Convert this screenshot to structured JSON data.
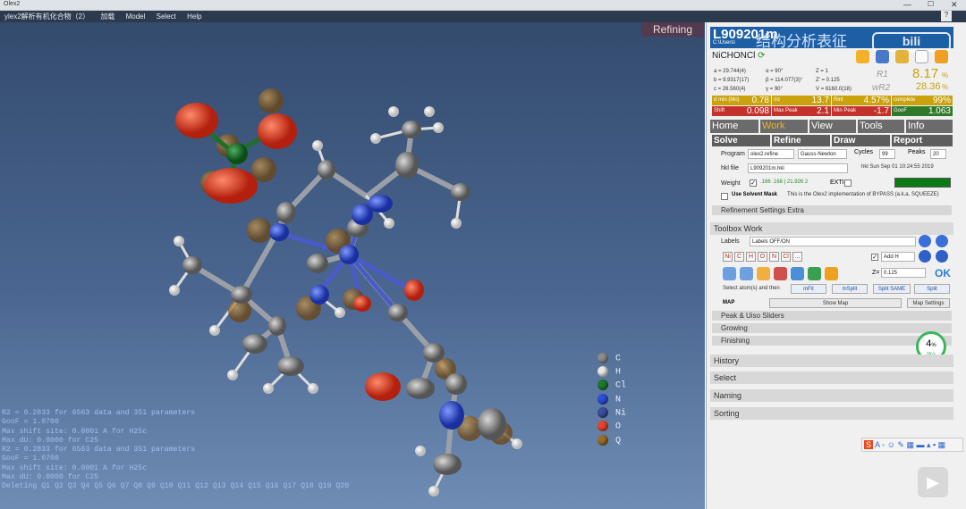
{
  "window": {
    "title": "Olex2"
  },
  "menu": {
    "items": [
      "ylex2解析有机化合物（2）",
      "加载",
      "Model",
      "Select",
      "Help"
    ]
  },
  "viewport": {
    "status_overlay": "Refining",
    "console_lines": [
      "R2 = 0.2833 for 6563 data and 351 parameters",
      "GooF = 1.0700",
      "Max shift site: 0.0001 A for H25c",
      "Max dU: 0.0000 for C25",
      "R2 = 0.2833 for 6563 data and 351 parameters",
      "GooF = 1.0700",
      "Max shift site: 0.0001 A for H25c",
      "Max dU: 0.0000 for C25",
      "Deleting Q1 Q2 Q3 Q4 Q5 Q6 Q7 Q8 Q9 Q10 Q11 Q12 Q13 Q14 Q15 Q16 Q17 Q18 Q19 Q20"
    ],
    "legend": [
      {
        "label": "C",
        "color": "#8c8c8c"
      },
      {
        "label": "H",
        "color": "#e8e8e8"
      },
      {
        "label": "Cl",
        "color": "#1f7a2e"
      },
      {
        "label": "N",
        "color": "#2b4fd9"
      },
      {
        "label": "Ni",
        "color": "#3a4f9e"
      },
      {
        "label": "O",
        "color": "#e6452d"
      },
      {
        "label": "Q",
        "color": "#9a6d2a"
      }
    ]
  },
  "panel": {
    "structure_name": "L909201m",
    "structure_path": "C:\\Users\\",
    "overlay_watermark": "结构分析表征",
    "formula": "NiCHONCl",
    "cell": {
      "a": "a = 29.744(4)",
      "alpha": "α = 90°",
      "Z": "Z = 1",
      "b": "b = 9.9317(17)",
      "beta": "β = 114.077(3)°",
      "Zp": "Z' = 0.125",
      "c": "c = 26.560(4)",
      "gamma": "γ = 90°",
      "V": "V = 6160.0(18)"
    },
    "r1_label": "R1",
    "r1_value": "8.17",
    "wr2_label": "wR2",
    "wr2_value": "28.36",
    "pct": "%",
    "stats": [
      {
        "label": "d min (Mo)",
        "value": "0.78",
        "color": "#c9a20d"
      },
      {
        "label": "I/σ",
        "value": "13.7",
        "color": "#c9a20d"
      },
      {
        "label": "Rint",
        "value": "4.57%",
        "color": "#c9a20d"
      },
      {
        "label": "complete",
        "value": "99%",
        "color": "#c9a20d"
      },
      {
        "label": "Shift",
        "value": "0.098",
        "color": "#c3322a"
      },
      {
        "label": "Max Peak",
        "value": "2.1",
        "color": "#c3322a"
      },
      {
        "label": "Min Peak",
        "value": "-1.7",
        "color": "#c3322a"
      },
      {
        "label": "GooF",
        "value": "1.063",
        "color": "#2f7a2a"
      }
    ],
    "tabs": [
      "Home",
      "Work",
      "View",
      "Tools",
      "Info"
    ],
    "active_tab": "Work",
    "subtabs": [
      "Solve",
      "Refine",
      "Draw",
      "Report"
    ],
    "program_label": "Program",
    "program_value": "olex2.refine",
    "method_value": "Gauss-Newton",
    "cycles_label": "Cycles",
    "cycles_value": "99",
    "peaks_label": "Peaks",
    "peaks_value": "20",
    "hkl_label": "hkl file",
    "hkl_value": "L909201m.hkl",
    "hkl_info": "hkl  Sun Sep 01 10:24:55 2019",
    "weight_label": "Weight",
    "weight_value": ".166 .168 | 21.926 2",
    "exti_label": "EXTI",
    "solvent_label": "Use Solvent Mask",
    "solvent_desc": "This is the Olex2 implementation of BYPASS (a.k.a. SQUEEZE)",
    "refinement_extra": "Refinement Settings Extra",
    "toolbox_title": "Toolbox Work",
    "labels_label": "Labels",
    "labels_value": "Labels OFF/ON",
    "element_buttons": [
      "Ni",
      "C",
      "H",
      "O",
      "N",
      "Cl",
      "..."
    ],
    "add_h": "Add H",
    "z_label": "Z=",
    "z_value": "0.125",
    "ok": "OK",
    "select_atoms_label": "Select atom(s) and then",
    "action_buttons": [
      "mFit",
      "mSplit",
      "Split SAME",
      "Split"
    ],
    "map_label": "MAP",
    "show_map": "Show Map",
    "map_settings": "Map Settings",
    "sections_a": [
      "Peak & Uiso Sliders",
      "Growing",
      "Finishing"
    ],
    "sections_b": [
      "History",
      "Select",
      "Naming",
      "Sorting"
    ],
    "net_speed": "4",
    "net_unit": "%",
    "net_rate": "0K/s"
  }
}
